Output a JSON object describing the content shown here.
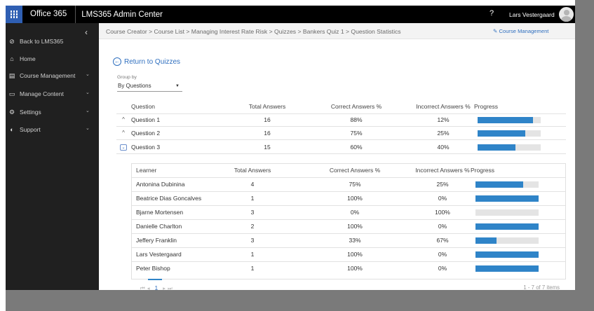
{
  "topbar": {
    "office_title": "Office 365",
    "app_title": "LMS365 Admin Center",
    "help": "?",
    "user_name": "Lars Vestergaard"
  },
  "sidebar": {
    "collapse": "‹",
    "items": [
      {
        "label": "Back to LMS365",
        "icon": "back-circle-icon",
        "glyph": "⊘",
        "chevron": false
      },
      {
        "label": "Home",
        "icon": "home-icon",
        "glyph": "⌂",
        "chevron": false
      },
      {
        "label": "Course Management",
        "icon": "book-icon",
        "glyph": "▤",
        "chevron": true
      },
      {
        "label": "Manage Content",
        "icon": "folder-icon",
        "glyph": "▭",
        "chevron": true
      },
      {
        "label": "Settings",
        "icon": "gear-icon",
        "glyph": "⚙",
        "chevron": true
      },
      {
        "label": "Support",
        "icon": "support-icon",
        "glyph": "◐",
        "chevron": true
      }
    ]
  },
  "breadcrumb": "Course Creator  >  Course List  >  Managing Interest Rate Risk  >  Quizzes  >  Bankers Quiz 1  >  Question Statistics",
  "course_management_link": "Course Management",
  "return_link": "Return to Quizzes",
  "group_by": {
    "label": "Group by",
    "value": "By Questions"
  },
  "questions_table": {
    "headers": [
      "Question",
      "Total Answers",
      "Correct Answers %",
      "Incorrect Answers %",
      "Progress"
    ],
    "rows": [
      {
        "question": "Question 1",
        "total": "16",
        "correct": "88%",
        "incorrect": "12%",
        "progress": 0.88,
        "expanded": false
      },
      {
        "question": "Question 2",
        "total": "16",
        "correct": "75%",
        "incorrect": "25%",
        "progress": 0.75,
        "expanded": false
      },
      {
        "question": "Question 3",
        "total": "15",
        "correct": "60%",
        "incorrect": "40%",
        "progress": 0.6,
        "expanded": true
      }
    ]
  },
  "learners_table": {
    "headers": [
      "Learner",
      "Total Answers",
      "Correct Answers %",
      "Incorrect Answers %",
      "Progress"
    ],
    "rows": [
      {
        "learner": "Antonina Dubinina",
        "total": "4",
        "correct": "75%",
        "incorrect": "25%",
        "progress": 0.75
      },
      {
        "learner": "Beatrice Dias Goncalves",
        "total": "1",
        "correct": "100%",
        "incorrect": "0%",
        "progress": 1.0
      },
      {
        "learner": "Bjarne Mortensen",
        "total": "3",
        "correct": "0%",
        "incorrect": "100%",
        "progress": 0.0
      },
      {
        "learner": "Danielle Charlton",
        "total": "2",
        "correct": "100%",
        "incorrect": "0%",
        "progress": 1.0
      },
      {
        "learner": "Jeffery Franklin",
        "total": "3",
        "correct": "33%",
        "incorrect": "67%",
        "progress": 0.33
      },
      {
        "learner": "Lars Vestergaard",
        "total": "1",
        "correct": "100%",
        "incorrect": "0%",
        "progress": 1.0
      },
      {
        "learner": "Peter Bishop",
        "total": "1",
        "correct": "100%",
        "incorrect": "0%",
        "progress": 1.0
      }
    ],
    "pager": {
      "first": "⏮",
      "prev": "◂",
      "current": "1",
      "next": "▸",
      "last": "⏭",
      "count": "1 - 7 of 7 items"
    }
  },
  "colors": {
    "accent": "#2f6fbf",
    "bar_fill": "#2f84c8",
    "bar_track": "#e4e4e4",
    "sidebar": "#202020",
    "topbar": "#000000",
    "waffle": "#2f5fb3"
  }
}
